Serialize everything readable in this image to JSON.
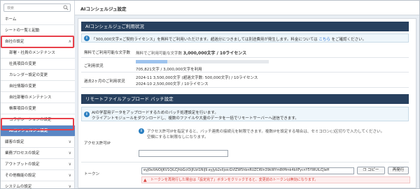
{
  "sidebar": {
    "search_placeholder": "検索",
    "items": [
      {
        "label": "ホーム",
        "type": "top"
      },
      {
        "label": "シートの一覧と起動",
        "type": "top"
      },
      {
        "label": "自社の設定",
        "type": "group",
        "chevron": "∧"
      },
      {
        "label": "部署・社員のメンテナンス",
        "type": "sub"
      },
      {
        "label": "社員項目の変更",
        "type": "sub"
      },
      {
        "label": "カレンダー設定の変更",
        "type": "sub"
      },
      {
        "label": "自社情報の変更",
        "type": "sub"
      },
      {
        "label": "自社部署のメンテナンス",
        "type": "sub"
      },
      {
        "label": "帳票項目の変更",
        "type": "sub"
      },
      {
        "label": "コラボレーションの設定",
        "type": "sub"
      },
      {
        "label": "AIコンシェルジュ設定",
        "type": "active"
      },
      {
        "label": "顧客の設定",
        "type": "group",
        "chevron": "∨"
      },
      {
        "label": "業務プロセスの設定",
        "type": "group",
        "chevron": "∨"
      },
      {
        "label": "アウトプットの設定",
        "type": "group",
        "chevron": "∨"
      },
      {
        "label": "その他機能の設定",
        "type": "group",
        "chevron": "∨"
      },
      {
        "label": "システムの設定",
        "type": "group",
        "chevron": "∨"
      }
    ]
  },
  "header": {
    "title": "AIコンシェルジュ設定"
  },
  "usage": {
    "title": "AIコンシェルジュご利用状況",
    "notice_pre": "「300,000文字×ご契約ライセンス」を無料でご利用いただけます。超過分につきましては別途費用が発生します。料金については",
    "notice_link": "こちら",
    "notice_post": "をご確認ください。",
    "free_label": "無料でご利用可能な文字数",
    "free_value_pre": "無料でご利用可能な文字数",
    "free_value_strong": "3,000,000文字 / 10ライセンス",
    "status_label": "ご利用状況",
    "status_fraction": 0.235,
    "status_value": "705,821文字 / 3,000,000文字を利用",
    "history_label": "過去2ヶ月のご利用状況",
    "history_1": "2024-11 3,500,000文字 (超過文字数: 500,000文字) / 10ライセンス",
    "history_2": "2024-10 2,500,000文字 / 10ライセンス"
  },
  "upload": {
    "title": "リモートファイルアップロード バッチ設定",
    "notice_line1": "AIの学習用データをアップロードするためのバッチ処理設定を行います。",
    "notice_line2": "クライアントモジュールをダウンロードし、複数のファイルや大量のデータを一括でリモートサーバーへ送信できます。",
    "ip_label": "アクセス許可IP",
    "ip_help_1": "アクセス許可IPを指定すると、バッチ連携の接続元を制限できます。複数IPを設定する場合は、セミコロン(;)区切りで入力してください。",
    "ip_help_2": "空欄にすると制限なしになります。",
    "ip_value": "",
    "token_label": "トークン",
    "token_value": "eyJ0eXAiOiJKV1QiLCJhbGciOiJIUzI1NiJ9.eyJyb2xlIjoicGVIZW5hbnRUZCI6In39kWYm8tMmk4bXFycnY5YWUiLCJleH",
    "copy_label": "コピー",
    "reissue_label": "再発行",
    "warning": "トークンを再発行した場合は「設定完了」ボタンをクリックすると、変更前のトークンは無効になります。"
  },
  "colors": {
    "header_bg": "#27405e",
    "active_nav": "#5a86c4",
    "highlight": "#e8404a",
    "link": "#1e6bd6"
  }
}
